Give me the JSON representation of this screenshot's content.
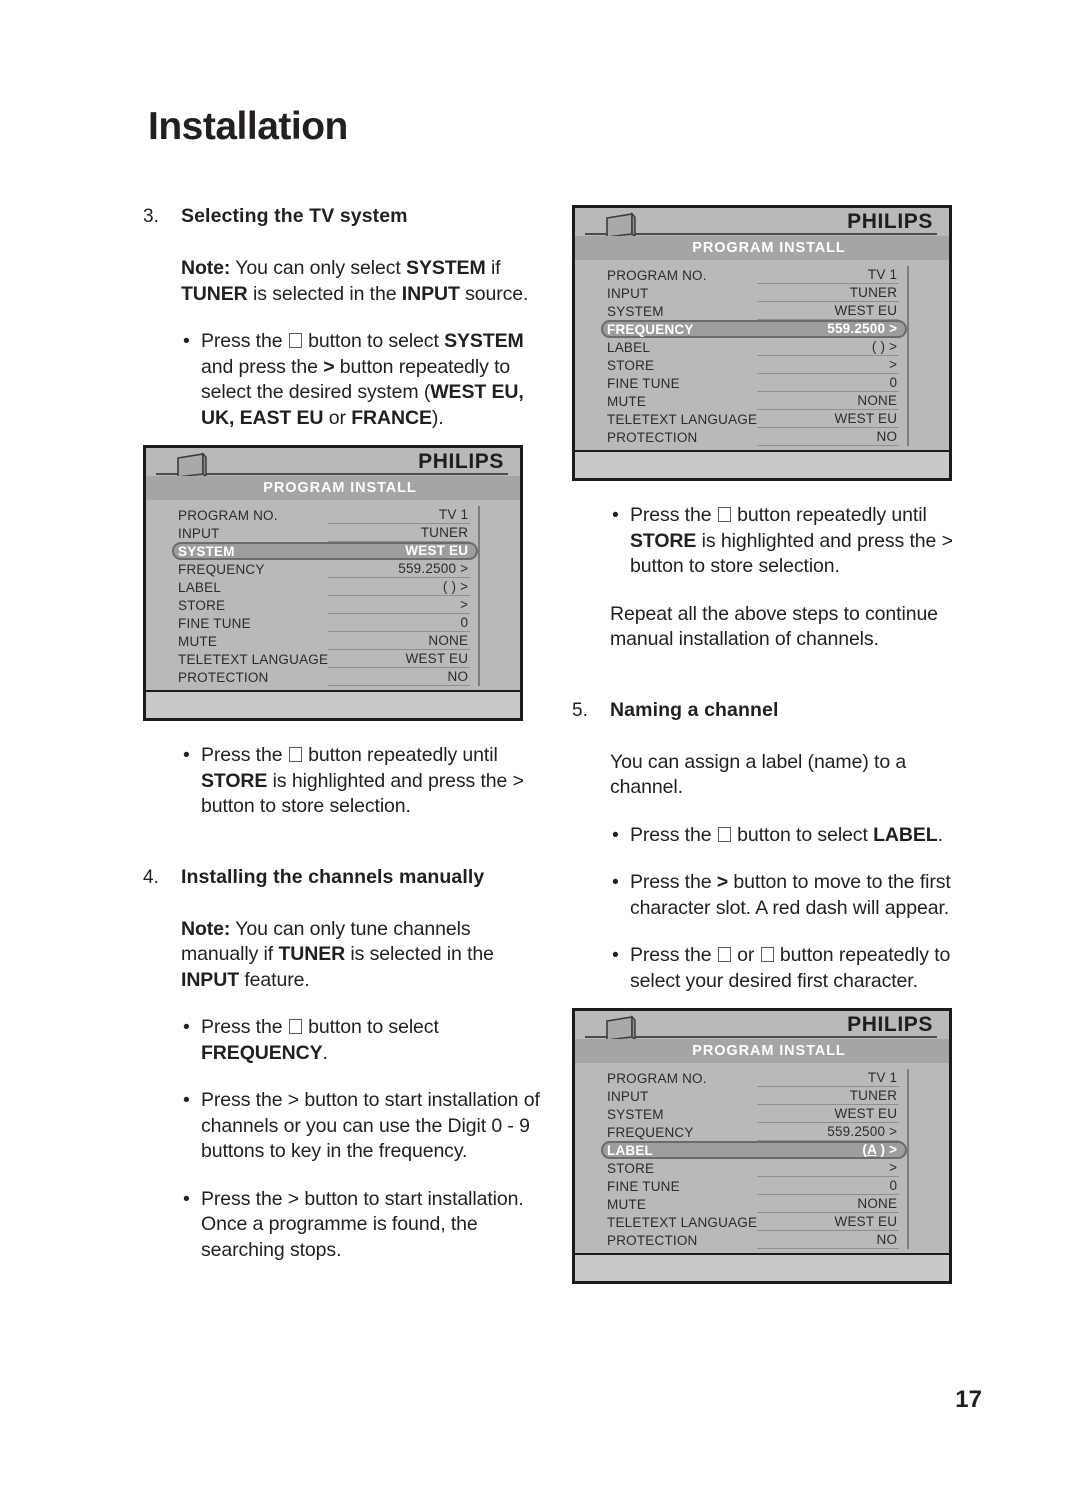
{
  "page": {
    "title": "Installation",
    "number": "17"
  },
  "osd_common": {
    "brand": "PHILIPS",
    "subtitle": "PROGRAM INSTALL",
    "tv_icon": "tv-screen-icon",
    "labels": {
      "program_no": "PROGRAM NO.",
      "input": "INPUT",
      "system": "SYSTEM",
      "frequency": "FREQUENCY",
      "label": "LABEL",
      "store": "STORE",
      "fine_tune": "FINE TUNE",
      "mute": "MUTE",
      "teletext_language": "TELETEXT LANGUAGE",
      "protection": "PROTECTION"
    },
    "values": {
      "program_no": "TV 1",
      "input": "TUNER",
      "system": "WEST EU",
      "frequency": "559.2500 >",
      "label_empty": "(            )  >",
      "label_a_pre": "(",
      "label_a_char": "A",
      "label_a_post": "        )  >",
      "store": ">",
      "fine_tune": "0",
      "mute": "NONE",
      "teletext_language": "WEST EU",
      "protection": "NO"
    }
  },
  "osd_screens": [
    {
      "name": "system-highlighted",
      "selected": "system"
    },
    {
      "name": "frequency-highlighted",
      "selected": "frequency"
    },
    {
      "name": "label-highlighted",
      "selected": "label"
    }
  ],
  "left_column": {
    "section3": {
      "number": "3.",
      "heading": "Selecting the TV system",
      "note_label": "Note:",
      "note_t1": " You can only select ",
      "note_b1": "SYSTEM",
      "note_t2": " if ",
      "note_b2": "TUNER",
      "note_t3": " is selected in the ",
      "note_b3": "INPUT",
      "note_t4": " source.",
      "bullet1_t1": "Press the ",
      "bullet1_t2": " button to select ",
      "bullet1_b1": "SYSTEM",
      "bullet1_t3": " and press the  ",
      "bullet1_sym": ">",
      "bullet1_t4": "  button repeatedly to select the desired system (",
      "bullet1_b2": "WEST EU, UK, EAST EU",
      "bullet1_t5": " or ",
      "bullet1_b3": "FRANCE",
      "bullet1_t6": ")."
    },
    "store_bullet": {
      "t1": "Press the ",
      "t2": " button repeatedly until ",
      "b1": "STORE",
      "t3": " is highlighted and press the > button to store selection."
    },
    "section4": {
      "number": "4.",
      "heading": "Installing the channels manually",
      "note_label": "Note:",
      "note_t1": " You can only tune channels manually if ",
      "note_b1": "TUNER",
      "note_t2": " is selected in the ",
      "note_b2": "INPUT",
      "note_t3": " feature.",
      "bullet1_t1": "Press the ",
      "bullet1_t2": " button to select ",
      "bullet1_b1": "FREQUENCY",
      "bullet1_t3": ".",
      "bullet2": "Press the  > button to start installation of channels or you can use the Digit 0 - 9 buttons to key in the frequency.",
      "bullet3": "Press the > button to start installation. Once a programme is found, the searching stops."
    }
  },
  "right_column": {
    "store_bullet": {
      "t1": "Press the ",
      "t2": " button repeatedly until ",
      "b1": "STORE",
      "t3": " is highlighted and press the > button to store selection."
    },
    "repeat_para": "Repeat all the above steps to continue manual installation of channels.",
    "section5": {
      "number": "5.",
      "heading": "Naming a channel",
      "para": "You can assign a label (name) to a channel.",
      "bullet1_t1": "Press the ",
      "bullet1_t2": " button to select ",
      "bullet1_b1": "LABEL",
      "bullet1_t3": ".",
      "bullet2_t1": "Press the  ",
      "bullet2_sym": ">",
      "bullet2_t2": "  button to move to  the first character slot. A red dash will appear.",
      "bullet3_t1": "Press the ",
      "bullet3_t2": " or ",
      "bullet3_t3": " button repeatedly to select your desired first character."
    }
  },
  "colors": {
    "osd_background": "#b9b9b9",
    "osd_border": "#1d1a1a",
    "osd_selected": "#9d9d9d",
    "osd_subtitle_band": "#a5a5a5",
    "text": "#231f20"
  }
}
